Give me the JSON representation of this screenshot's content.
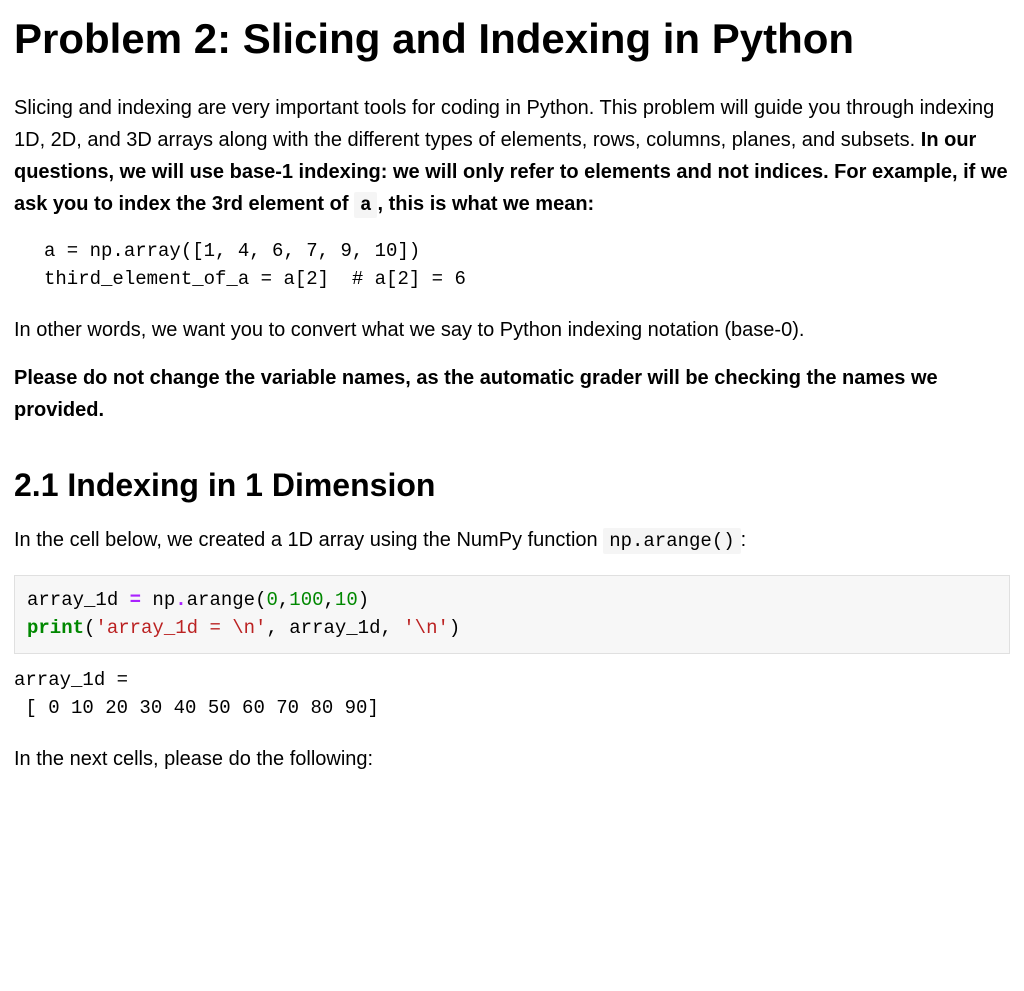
{
  "h1": "Problem 2: Slicing and Indexing in Python",
  "intro": {
    "p1a": "Slicing and indexing are very important tools for coding in Python. This problem will guide you through indexing 1D, 2D, and 3D arrays along with the different types of elements, rows, columns, planes, and subsets. ",
    "p1b_bold_pre": "In our questions, we will use base-1 indexing: we will only refer to elements and not indices. For example, if we ask you to index the 3rd element of ",
    "p1b_code": "a",
    "p1b_bold_post": ", this is what we mean:"
  },
  "example_code": "a = np.array([1, 4, 6, 7, 9, 10])\nthird_element_of_a = a[2]  # a[2] = 6",
  "p2": "In other words, we want you to convert what we say to Python indexing notation (base-0).",
  "p3_bold": "Please do not change the variable names, as the automatic grader will be checking the names we provided.",
  "h2": "2.1 Indexing in 1 Dimension",
  "section": {
    "p1a": "In the cell below, we created a 1D array using the NumPy function ",
    "p1_code": "np.arange()",
    "p1b": ":"
  },
  "code_cell_parts": {
    "l1_ident1": "array_1d ",
    "l1_eq": "=",
    "l1_np": " np",
    "l1_dot1": ".",
    "l1_arange": "arange(",
    "l1_n0": "0",
    "l1_c1": ",",
    "l1_n100": "100",
    "l1_c2": ",",
    "l1_n10": "10",
    "l1_close": ")",
    "l2_print": "print",
    "l2_open": "(",
    "l2_s1": "'array_1d = \\n'",
    "l2_c1": ", array_1d, ",
    "l2_s2": "'\\n'",
    "l2_close": ")"
  },
  "output": "array_1d =\n [ 0 10 20 30 40 50 60 70 80 90]",
  "p_next": "In the next cells, please do the following:"
}
